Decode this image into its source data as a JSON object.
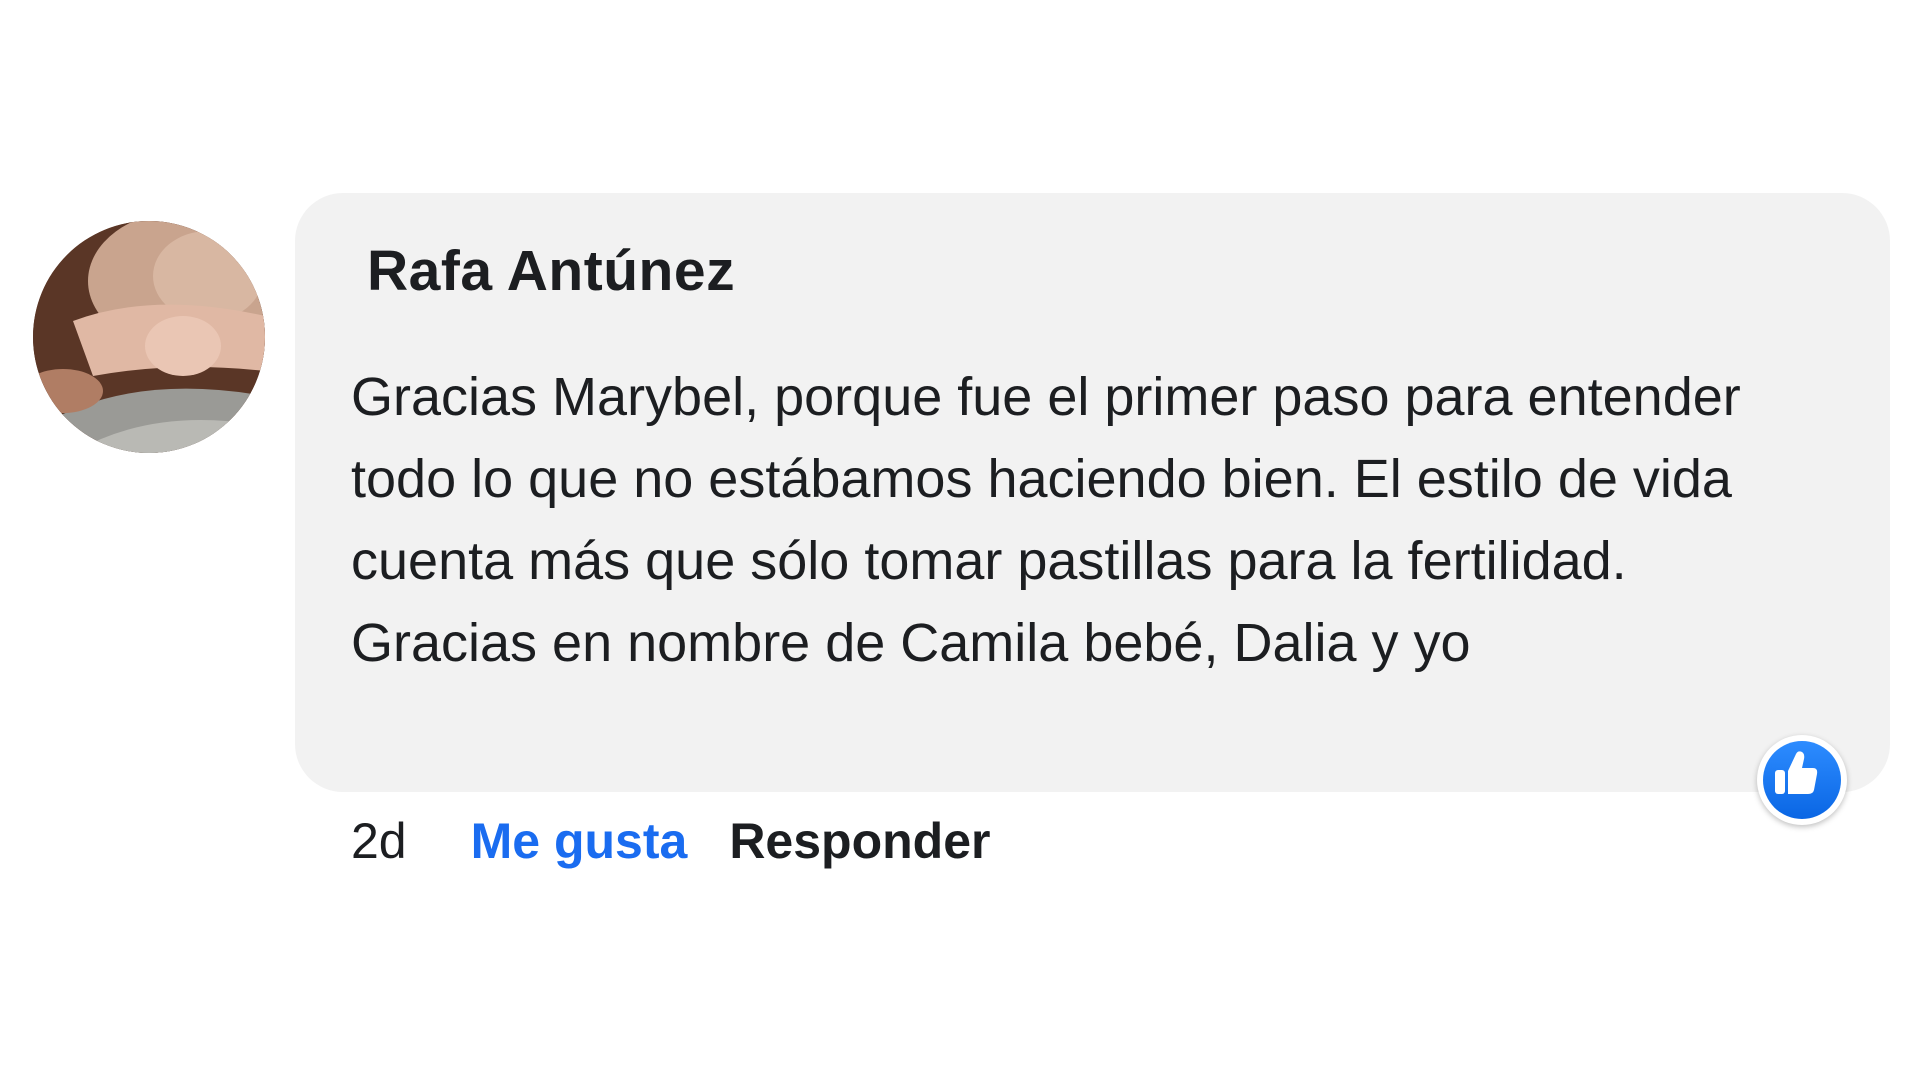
{
  "comment": {
    "author": "Rafa Antúnez",
    "text": "Gracias Marybel, porque fue el primer paso para entender todo lo que no estábamos haciendo bien. El estilo de vida cuenta más que sólo tomar pastillas para la fertilidad. Gracias en nombre de Camila bebé, Dalia y yo",
    "timestamp": "2d",
    "like_label": "Me gusta",
    "reply_label": "Responder",
    "reaction_icon": "thumbs-up-icon"
  },
  "colors": {
    "bubble_background": "#f2f2f2",
    "like_link": "#1a6cf0",
    "reaction_badge": "#1877f2",
    "text": "#1c1e21"
  }
}
